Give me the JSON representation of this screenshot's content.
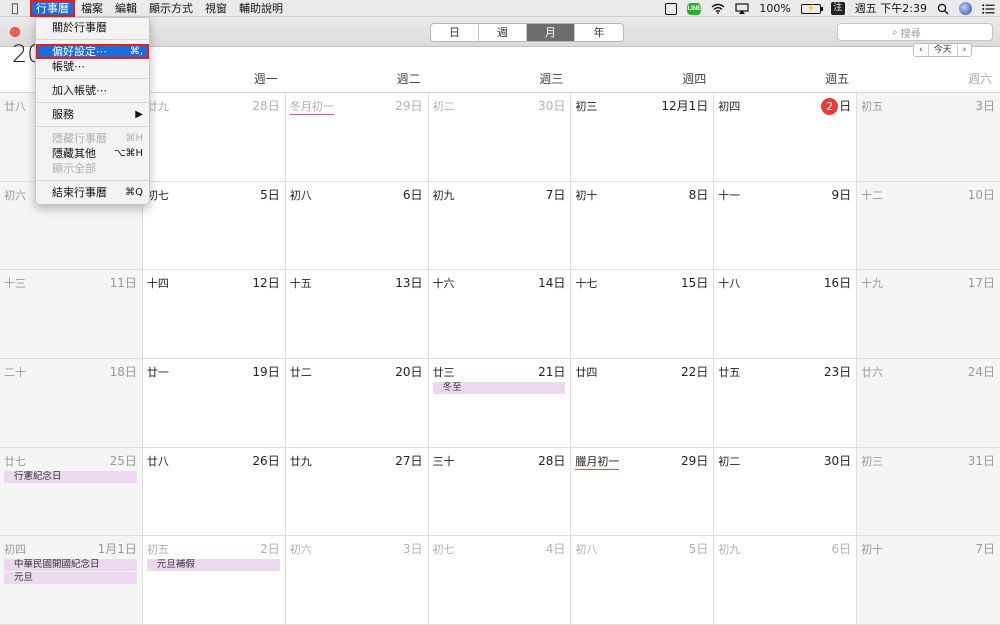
{
  "menubar": {
    "apple_icon": "apple-icon",
    "items": [
      "行事曆",
      "檔案",
      "編輯",
      "顯示方式",
      "視窗",
      "輔助說明"
    ],
    "active_index": 0
  },
  "status": {
    "battery": "100%",
    "ime": "注",
    "clock": "週五 下午2:39",
    "icons": [
      "screen-icon",
      "line-icon",
      "wifi-icon",
      "airplay-icon",
      "battery-icon",
      "search-icon",
      "user-icon",
      "list-icon"
    ]
  },
  "dropdown": {
    "items": [
      {
        "label": "關於行事曆",
        "shortcut": "",
        "disabled": false
      },
      {
        "sep": true
      },
      {
        "label": "偏好設定⋯",
        "shortcut": "⌘,",
        "disabled": false,
        "selected": true
      },
      {
        "label": "帳號⋯",
        "shortcut": "",
        "disabled": false
      },
      {
        "sep": true
      },
      {
        "label": "加入帳號⋯",
        "shortcut": "",
        "disabled": false
      },
      {
        "sep": true
      },
      {
        "label": "服務",
        "shortcut": "▶",
        "disabled": false
      },
      {
        "sep": true
      },
      {
        "label": "隱藏行事曆",
        "shortcut": "⌘H",
        "disabled": true
      },
      {
        "label": "隱藏其他",
        "shortcut": "⌥⌘H",
        "disabled": false
      },
      {
        "label": "顯示全部",
        "shortcut": "",
        "disabled": true
      },
      {
        "sep": true
      },
      {
        "label": "結束行事曆",
        "shortcut": "⌘Q",
        "disabled": false
      }
    ]
  },
  "toolbar": {
    "view_buttons": [
      "日",
      "週",
      "月",
      "年"
    ],
    "selected_view": 2,
    "search_placeholder": "搜尋"
  },
  "calendar": {
    "title_partial": "20",
    "nav": {
      "prev": "‹",
      "today": "今天",
      "next": "›"
    },
    "weekdays": [
      "",
      "週一",
      "週二",
      "週三",
      "週四",
      "週五",
      "週六"
    ],
    "today_day": "2",
    "today_suffix": "日",
    "weeks": [
      [
        {
          "lunar": "廿八",
          "date": "",
          "out": true,
          "weekend": true
        },
        {
          "lunar": "廿九",
          "date": "28日",
          "out": true
        },
        {
          "lunar": "冬月初一",
          "date": "29日",
          "out": true,
          "holiday": true
        },
        {
          "lunar": "初二",
          "date": "30日",
          "out": true
        },
        {
          "lunar": "初三",
          "date": "12月1日"
        },
        {
          "lunar": "初四",
          "date": "日",
          "today": true
        },
        {
          "lunar": "初五",
          "date": "3日",
          "weekend": true
        }
      ],
      [
        {
          "lunar": "初六",
          "date": "",
          "weekend": true
        },
        {
          "lunar": "初七",
          "date": "5日"
        },
        {
          "lunar": "初八",
          "date": "6日"
        },
        {
          "lunar": "初九",
          "date": "7日"
        },
        {
          "lunar": "初十",
          "date": "8日"
        },
        {
          "lunar": "十一",
          "date": "9日"
        },
        {
          "lunar": "十二",
          "date": "10日",
          "weekend": true
        }
      ],
      [
        {
          "lunar": "十三",
          "date": "11日",
          "weekend": true
        },
        {
          "lunar": "十四",
          "date": "12日"
        },
        {
          "lunar": "十五",
          "date": "13日"
        },
        {
          "lunar": "十六",
          "date": "14日"
        },
        {
          "lunar": "十七",
          "date": "15日"
        },
        {
          "lunar": "十八",
          "date": "16日"
        },
        {
          "lunar": "十九",
          "date": "17日",
          "weekend": true
        }
      ],
      [
        {
          "lunar": "二十",
          "date": "18日",
          "weekend": true
        },
        {
          "lunar": "廿一",
          "date": "19日"
        },
        {
          "lunar": "廿二",
          "date": "20日"
        },
        {
          "lunar": "廿三",
          "date": "21日",
          "events": [
            "冬至"
          ]
        },
        {
          "lunar": "廿四",
          "date": "22日"
        },
        {
          "lunar": "廿五",
          "date": "23日"
        },
        {
          "lunar": "廿六",
          "date": "24日",
          "weekend": true
        }
      ],
      [
        {
          "lunar": "廿七",
          "date": "25日",
          "weekend": true,
          "events": [
            "行憲紀念日"
          ]
        },
        {
          "lunar": "廿八",
          "date": "26日"
        },
        {
          "lunar": "廿九",
          "date": "27日"
        },
        {
          "lunar": "三十",
          "date": "28日"
        },
        {
          "lunar": "臘月初一",
          "date": "29日",
          "holiday": true
        },
        {
          "lunar": "初二",
          "date": "30日"
        },
        {
          "lunar": "初三",
          "date": "31日",
          "weekend": true
        }
      ],
      [
        {
          "lunar": "初四",
          "date": "1月1日",
          "out": true,
          "weekend": true,
          "events": [
            "中華民國開國紀念日",
            "元旦"
          ]
        },
        {
          "lunar": "初五",
          "date": "2日",
          "out": true,
          "events": [
            "元旦補假"
          ]
        },
        {
          "lunar": "初六",
          "date": "3日",
          "out": true
        },
        {
          "lunar": "初七",
          "date": "4日",
          "out": true
        },
        {
          "lunar": "初八",
          "date": "5日",
          "out": true
        },
        {
          "lunar": "初九",
          "date": "6日",
          "out": true
        },
        {
          "lunar": "初十",
          "date": "7日",
          "out": true,
          "weekend": true
        }
      ]
    ]
  }
}
